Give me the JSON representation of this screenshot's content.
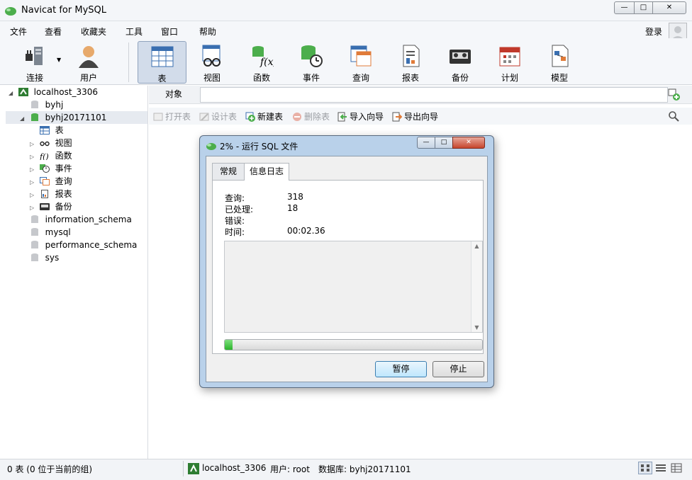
{
  "window": {
    "title": "Navicat for MySQL",
    "min_glyph": "—",
    "max_glyph": "□",
    "close_glyph": "✕"
  },
  "menu": {
    "items": [
      "文件",
      "查看",
      "收藏夹",
      "工具",
      "窗口",
      "帮助"
    ],
    "login": "登录"
  },
  "toolbar": {
    "items": [
      {
        "label": "连接",
        "icon": "connection-icon"
      },
      {
        "label": "用户",
        "icon": "user-icon"
      },
      {
        "label": "表",
        "icon": "table-icon",
        "active": true
      },
      {
        "label": "视图",
        "icon": "view-icon"
      },
      {
        "label": "函数",
        "icon": "function-icon"
      },
      {
        "label": "事件",
        "icon": "event-icon"
      },
      {
        "label": "查询",
        "icon": "query-icon"
      },
      {
        "label": "报表",
        "icon": "report-icon"
      },
      {
        "label": "备份",
        "icon": "backup-icon"
      },
      {
        "label": "计划",
        "icon": "schedule-icon"
      },
      {
        "label": "模型",
        "icon": "model-icon"
      }
    ]
  },
  "sidebar": {
    "connection": "localhost_3306",
    "databases": [
      {
        "name": "byhj"
      },
      {
        "name": "byhj20171101",
        "open": true
      }
    ],
    "children": [
      {
        "label": "表",
        "icon": "table-icon"
      },
      {
        "label": "视图",
        "icon": "view-icon"
      },
      {
        "label": "函数",
        "icon": "function-icon"
      },
      {
        "label": "事件",
        "icon": "event-icon"
      },
      {
        "label": "查询",
        "icon": "query-icon"
      },
      {
        "label": "报表",
        "icon": "report-icon"
      },
      {
        "label": "备份",
        "icon": "backup-icon"
      }
    ],
    "other_databases": [
      "information_schema",
      "mysql",
      "performance_schema",
      "sys"
    ]
  },
  "objects": {
    "tab": "对象",
    "actions": [
      {
        "label": "打开表",
        "enabled": false,
        "icon": "open-table-icon"
      },
      {
        "label": "设计表",
        "enabled": false,
        "icon": "design-table-icon"
      },
      {
        "label": "新建表",
        "enabled": true,
        "icon": "new-table-icon"
      },
      {
        "label": "删除表",
        "enabled": false,
        "icon": "delete-table-icon"
      },
      {
        "label": "导入向导",
        "enabled": true,
        "icon": "import-wizard-icon"
      },
      {
        "label": "导出向导",
        "enabled": true,
        "icon": "export-wizard-icon"
      }
    ]
  },
  "status": {
    "left": "0 表 (0 位于当前的组)",
    "connection": "localhost_3306",
    "user": "用户: root",
    "database": "数据库: byhj20171101"
  },
  "dialog": {
    "title": "2% - 运行 SQL 文件",
    "tabs": [
      "常规",
      "信息日志"
    ],
    "active_tab": 1,
    "fields": [
      {
        "label": "查询:",
        "value": "318"
      },
      {
        "label": "已处理:",
        "value": "18"
      },
      {
        "label": "错误:",
        "value": ""
      },
      {
        "label": "时间:",
        "value": "00:02.36"
      }
    ],
    "progress_fraction": 0.03,
    "pause_label": "暂停",
    "stop_label": "停止"
  },
  "colors": {
    "accent": "#4cae4c",
    "selection": "#d2dcea",
    "dialog_frame": "#b9d1ea"
  }
}
